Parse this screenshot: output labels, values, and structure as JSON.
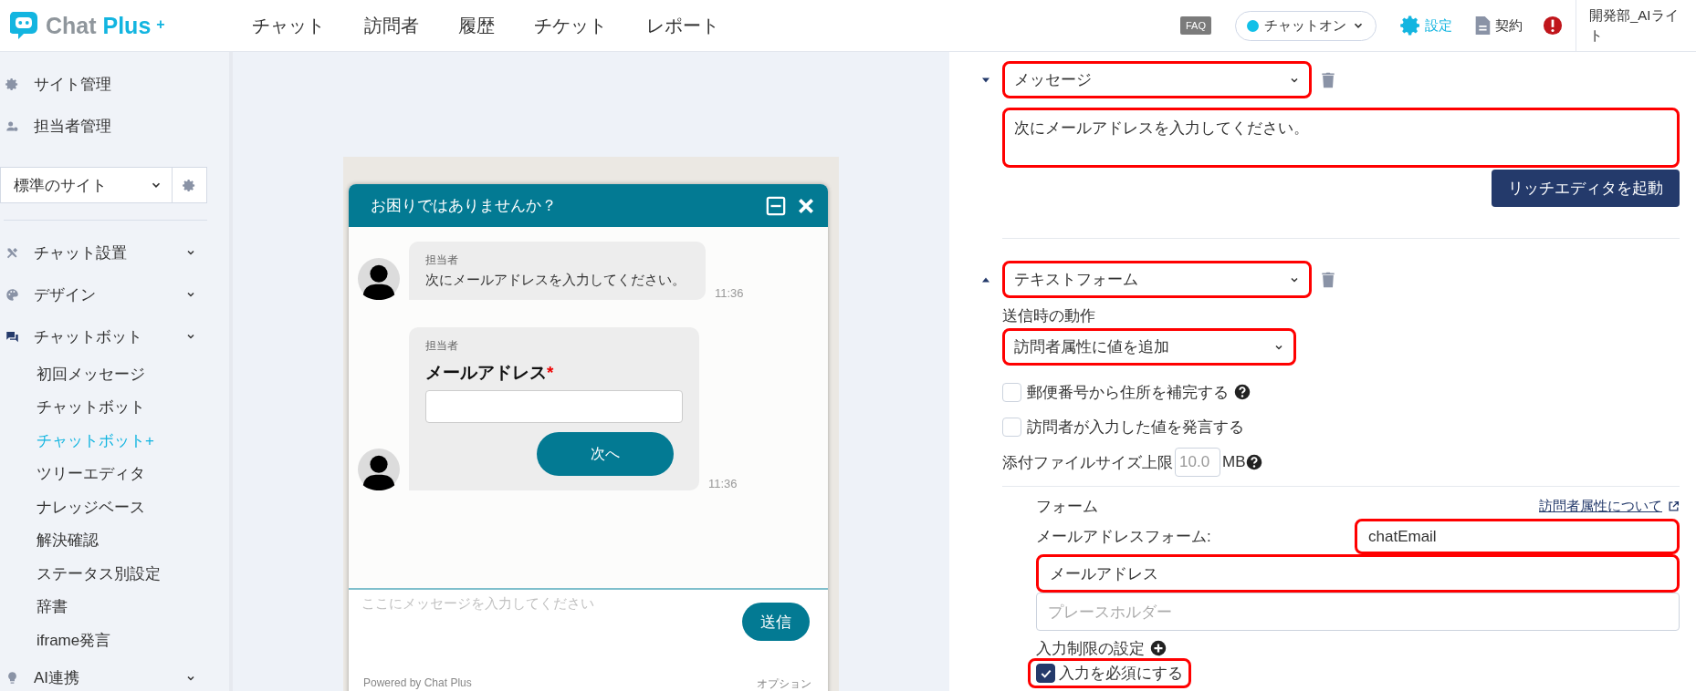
{
  "header": {
    "logo": {
      "word": "Chat",
      "accent": "Plus",
      "mark": "+"
    },
    "nav": [
      "チャット",
      "訪問者",
      "履歴",
      "チケット",
      "レポート"
    ],
    "faq": "FAQ",
    "status": "チャットオン",
    "settings": "設定",
    "contract": "契約",
    "account": "開発部_AIライト"
  },
  "sidebar": {
    "admin": [
      "サイト管理",
      "担当者管理"
    ],
    "site_select": "標準のサイト",
    "sections": [
      {
        "label": "チャット設置"
      },
      {
        "label": "デザイン"
      },
      {
        "label": "チャットボット",
        "children": [
          {
            "label": "初回メッセージ",
            "selected": false
          },
          {
            "label": "チャットボット",
            "selected": false
          },
          {
            "label": "チャットボット+",
            "selected": true
          },
          {
            "label": "ツリーエディタ",
            "selected": false
          },
          {
            "label": "ナレッジベース",
            "selected": false
          },
          {
            "label": "解決確認",
            "selected": false
          },
          {
            "label": "ステータス別設定",
            "selected": false
          },
          {
            "label": "辞書",
            "selected": false
          },
          {
            "label": "iframe発言",
            "selected": false
          }
        ]
      },
      {
        "label": "AI連携"
      }
    ]
  },
  "preview": {
    "title": "お困りではありませんか？",
    "messages": [
      {
        "kind": "text",
        "sender": "担当者",
        "text": "次にメールアドレスを入力してください。",
        "time": "11:36"
      },
      {
        "kind": "form",
        "sender": "担当者",
        "label": "メールアドレス",
        "required_mark": "*",
        "button": "次へ",
        "time": "11:36"
      }
    ],
    "input_placeholder": "ここにメッセージを入力してください",
    "send": "送信",
    "powered": "Powered by Chat Plus",
    "option": "オプション"
  },
  "editor": {
    "blocks": [
      {
        "kind": "message",
        "caret_up": false,
        "type": "メッセージ",
        "type_highlighted": true,
        "text": "次にメールアドレスを入力してください。",
        "text_highlighted": true,
        "button": "リッチエディタを起動"
      },
      {
        "kind": "text_form",
        "caret_up": true,
        "type": "テキストフォーム",
        "type_highlighted": true,
        "action_label": "送信時の動作",
        "action": "訪問者属性に値を追加",
        "action_highlighted": true,
        "options": [
          {
            "label": "郵便番号から住所を補完する",
            "checked": false,
            "help": true
          },
          {
            "label": "訪問者が入力した値を発言する",
            "checked": false,
            "help": false
          }
        ],
        "file_limit": {
          "label": "添付ファイルサイズ上限",
          "value": "10.0",
          "unit": "MB"
        },
        "form": {
          "heading": "フォーム",
          "link": "訪問者属性について",
          "field_label": "メールアドレスフォーム:",
          "attribute": "chatEmail",
          "attribute_highlighted": true,
          "name": "メールアドレス",
          "name_highlighted": true,
          "placeholder": "プレースホルダー",
          "restriction": "入力制限の設定",
          "required": {
            "label": "入力を必須にする",
            "checked": true,
            "highlighted": true
          }
        }
      }
    ]
  }
}
